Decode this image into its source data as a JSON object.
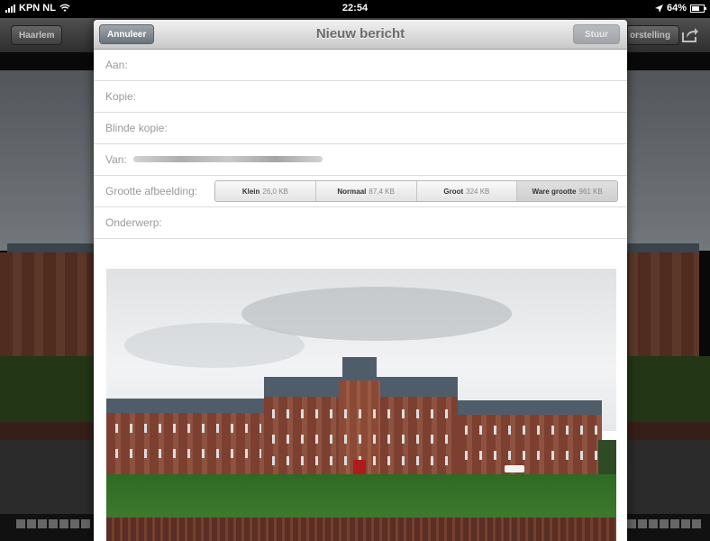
{
  "status_bar": {
    "carrier": "KPN NL",
    "time": "22:54",
    "battery": "64%"
  },
  "background_app": {
    "back_button": "Haarlem",
    "right_button_partial": "orstelling"
  },
  "compose": {
    "title": "Nieuw bericht",
    "cancel_label": "Annuleer",
    "send_label": "Stuur",
    "to_label": "Aan:",
    "cc_label": "Kopie:",
    "bcc_label": "Blinde kopie:",
    "from_label": "Van:",
    "image_size_label": "Grootte afbeelding:",
    "size_options": [
      {
        "name": "Klein",
        "size": "26,0 KB"
      },
      {
        "name": "Normaal",
        "size": "87,4 KB"
      },
      {
        "name": "Groot",
        "size": "324 KB"
      },
      {
        "name": "Ware grootte",
        "size": "961 KB"
      }
    ],
    "subject_label": "Onderwerp:"
  },
  "icons": {
    "wifi": "wifi-icon",
    "battery": "battery-icon",
    "location": "location-arrow-icon",
    "share": "share-icon"
  }
}
